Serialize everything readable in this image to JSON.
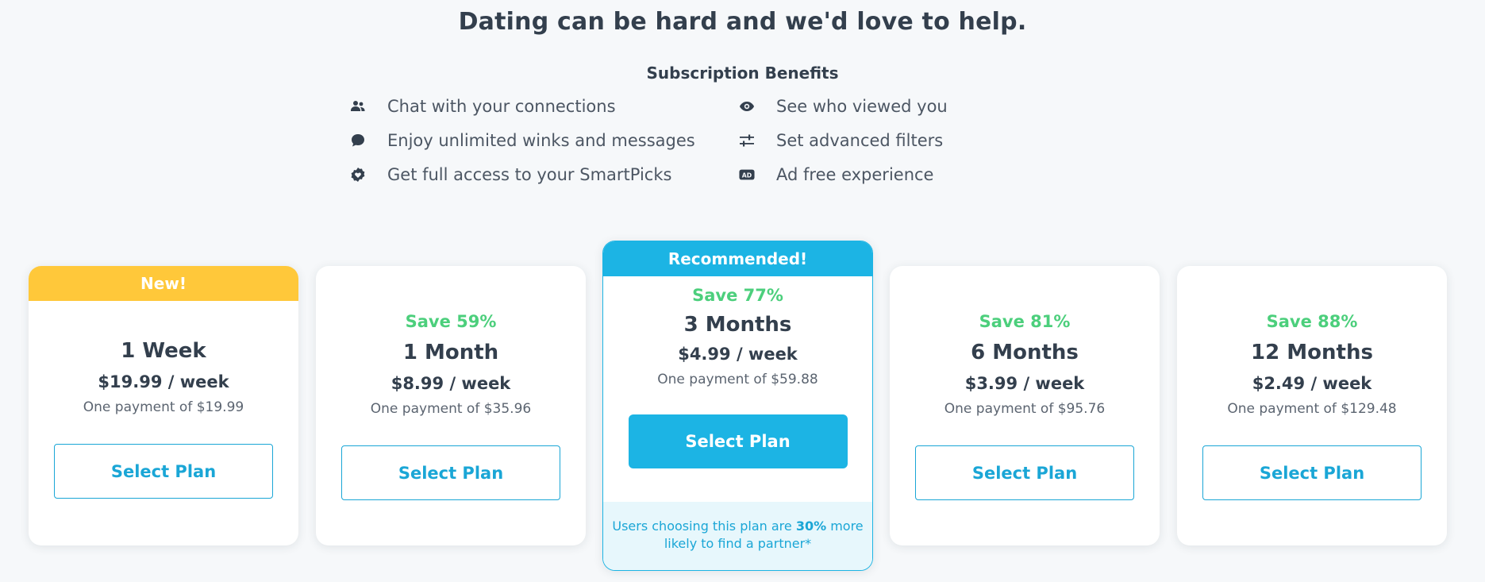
{
  "headline": "Dating can be hard and we'd love to help.",
  "benefits": {
    "title": "Subscription Benefits",
    "items": [
      {
        "icon": "people-icon",
        "label": "Chat with your connections"
      },
      {
        "icon": "chat-bubble-icon",
        "label": "Enjoy unlimited winks and messages"
      },
      {
        "icon": "smartpicks-heart-icon",
        "label": "Get full access to your SmartPicks"
      },
      {
        "icon": "eye-icon",
        "label": "See who viewed you"
      },
      {
        "icon": "sliders-icon",
        "label": "Set advanced filters"
      },
      {
        "icon": "ad-icon",
        "label": "Ad free experience"
      }
    ]
  },
  "plans": [
    {
      "badge": "New!",
      "save": "",
      "duration": "1 Week",
      "price": "$19.99 / week",
      "payment": "One payment of $19.99",
      "button": "Select Plan"
    },
    {
      "badge": "",
      "save": "Save 59%",
      "duration": "1 Month",
      "price": "$8.99 / week",
      "payment": "One payment of $35.96",
      "button": "Select Plan"
    },
    {
      "badge": "Recommended!",
      "save": "Save 77%",
      "duration": "3 Months",
      "price": "$4.99 / week",
      "payment": "One payment of $59.88",
      "button": "Select Plan",
      "footnote_pre": "Users choosing this plan are ",
      "footnote_bold": "30%",
      "footnote_post": " more likely to find a partner*"
    },
    {
      "badge": "",
      "save": "Save 81%",
      "duration": "6 Months",
      "price": "$3.99 / week",
      "payment": "One payment of $95.76",
      "button": "Select Plan"
    },
    {
      "badge": "",
      "save": "Save 88%",
      "duration": "12 Months",
      "price": "$2.49 / week",
      "payment": "One payment of $129.48",
      "button": "Select Plan"
    }
  ],
  "colors": {
    "accent": "#1cb4e4",
    "new_badge": "#ffc83a",
    "save_green": "#4ccf7c",
    "text_dark": "#333f4d"
  }
}
